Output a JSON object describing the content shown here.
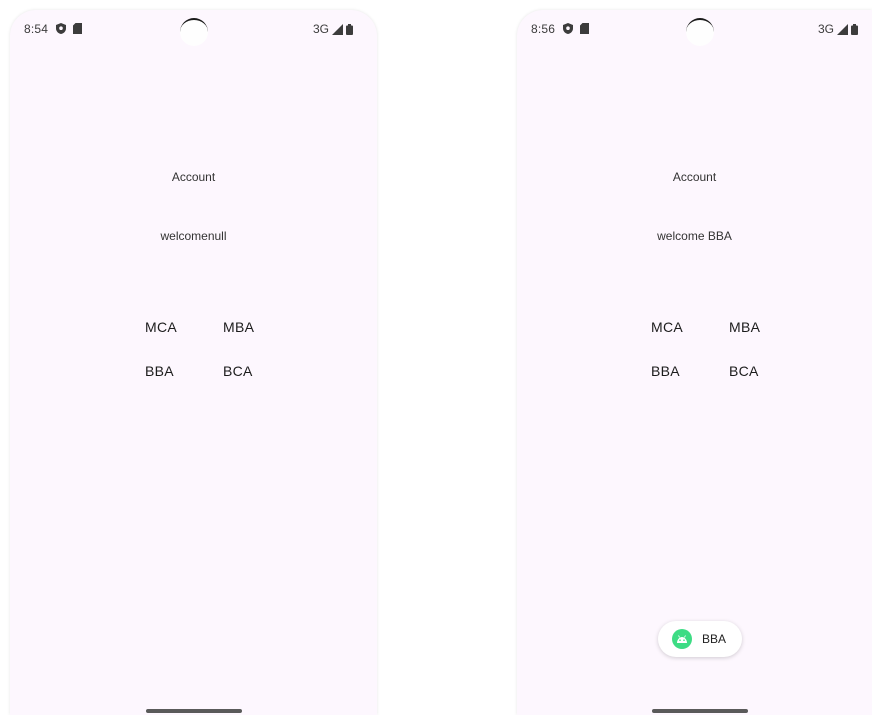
{
  "colors": {
    "screen_background": "#fdf7fe",
    "text_primary": "#1c1c1c",
    "toast_background": "#ffffff",
    "android_green": "#3ddc84"
  },
  "screens": [
    {
      "status_bar": {
        "time": "8:54",
        "network": "3G",
        "icons": [
          "shield-icon",
          "sd-card-icon",
          "signal-icon",
          "battery-icon"
        ]
      },
      "title": "Account",
      "welcome_text": "welcomenull",
      "buttons": [
        "MCA",
        "MBA",
        "BBA",
        "BCA"
      ]
    },
    {
      "status_bar": {
        "time": "8:56",
        "network": "3G",
        "icons": [
          "shield-icon",
          "sd-card-icon",
          "signal-icon",
          "battery-icon"
        ]
      },
      "title": "Account",
      "welcome_text": "welcome BBA",
      "buttons": [
        "MCA",
        "MBA",
        "BBA",
        "BCA"
      ],
      "toast": {
        "icon": "android-icon",
        "text": "BBA"
      }
    }
  ]
}
